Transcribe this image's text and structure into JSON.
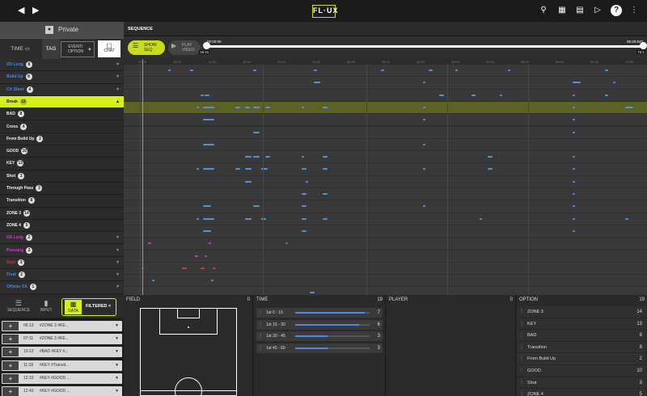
{
  "topbar": {
    "logo": "FL·UX",
    "back_icon": "chevron-left-icon",
    "forward_icon": "chevron-right-icon",
    "icons": [
      "search-icon",
      "calendar-icon",
      "playlist-icon",
      "video-icon",
      "help-icon",
      "menu-icon"
    ],
    "help_label": "?"
  },
  "left": {
    "privacy_label": "Private",
    "tabs": {
      "time": "TIME",
      "tag": "TAG",
      "event_option": "EVENT/ OPTION",
      "chat": "CHAT"
    },
    "rows": [
      {
        "label": "OX Long",
        "count": "8",
        "color": "#4a86e8"
      },
      {
        "label": "Build Up",
        "count": "8",
        "color": "#4a86e8"
      },
      {
        "label": "OX Short",
        "count": "4",
        "color": "#4a86e8"
      },
      {
        "label": "Break",
        "count": "19",
        "color": "#222222"
      },
      {
        "label": "BAD",
        "count": "8",
        "color": "#eeeeee"
      },
      {
        "label": "Cross",
        "count": "4",
        "color": "#eeeeee"
      },
      {
        "label": "From Build Up",
        "count": "2",
        "color": "#eeeeee"
      },
      {
        "label": "GOOD",
        "count": "10",
        "color": "#eeeeee"
      },
      {
        "label": "KEY",
        "count": "13",
        "color": "#eeeeee"
      },
      {
        "label": "Shot",
        "count": "3",
        "color": "#eeeeee"
      },
      {
        "label": "Through Pass",
        "count": "3",
        "color": "#eeeeee"
      },
      {
        "label": "Transition",
        "count": "8",
        "color": "#eeeeee"
      },
      {
        "label": "ZONE 3",
        "count": "14",
        "color": "#eeeeee"
      },
      {
        "label": "ZONE 4",
        "count": "5",
        "color": "#eeeeee"
      },
      {
        "label": "OX Long",
        "count": "2",
        "color": "#d63ad6"
      },
      {
        "label": "Pressing",
        "count": "2",
        "color": "#d63ad6"
      },
      {
        "label": "Shot",
        "count": "3",
        "color": "#e03030"
      },
      {
        "label": "Final",
        "count": "2",
        "color": "#4a86e8"
      },
      {
        "label": "Offside OX",
        "count": "1",
        "color": "#4a86e8"
      }
    ],
    "bottom_tabs": {
      "sequence": "SEQUENCE",
      "input": "INPUT",
      "data": "DATA",
      "filtered": "FILTERED"
    },
    "clips": [
      {
        "time": "06:13",
        "name": "#ZONE 3 #KE..."
      },
      {
        "time": "07:11",
        "name": "#ZONE 3 #KE..."
      },
      {
        "time": "10:12",
        "name": "#BAD #KEY #..."
      },
      {
        "time": "11:18",
        "name": "#KEY #Transit..."
      },
      {
        "time": "12:10",
        "name": "#KEY #GOOD ..."
      },
      {
        "time": "12:43",
        "name": "#KEY #GOOD ..."
      }
    ]
  },
  "sequence": {
    "header": "SEQUENCE",
    "show_seq": "SHOW SEQ",
    "play_video": "PLAY VIDEO",
    "time_start": "00:00:00",
    "time_end": "05:25:637",
    "time_left": "15:41",
    "time_right": "72:1",
    "ruler_ticks": [
      "00:00",
      "05:00",
      "10:00",
      "15:00",
      "20:00",
      "25:00",
      "30:00",
      "35:00",
      "40:00",
      "45:00",
      "50:00",
      "55:00",
      "60:00",
      "65:00",
      "70:00"
    ]
  },
  "stats": {
    "field": {
      "title": "FIELD",
      "count": "0"
    },
    "time": {
      "title": "TIME",
      "count": "19",
      "rows": [
        {
          "label": "1st 0 - 15",
          "value": 7,
          "frac": 0.93
        },
        {
          "label": "1st 15 - 30",
          "value": 6,
          "frac": 0.86
        },
        {
          "label": "1st 30 - 45",
          "value": 3,
          "frac": 0.43
        },
        {
          "label": "1st 45 - 60",
          "value": 3,
          "frac": 0.43
        }
      ]
    },
    "player": {
      "title": "PLAYER",
      "count": "0"
    },
    "option": {
      "title": "OPTION",
      "count": "19",
      "rows": [
        {
          "label": "ZONE 3",
          "value": "14"
        },
        {
          "label": "KEY",
          "value": "13"
        },
        {
          "label": "BAD",
          "value": "8"
        },
        {
          "label": "Transition",
          "value": "8"
        },
        {
          "label": "From Build Up",
          "value": "2"
        },
        {
          "label": "GOOD",
          "value": "10"
        },
        {
          "label": "Shot",
          "value": "3"
        },
        {
          "label": "ZONE 4",
          "value": "5"
        }
      ]
    }
  }
}
